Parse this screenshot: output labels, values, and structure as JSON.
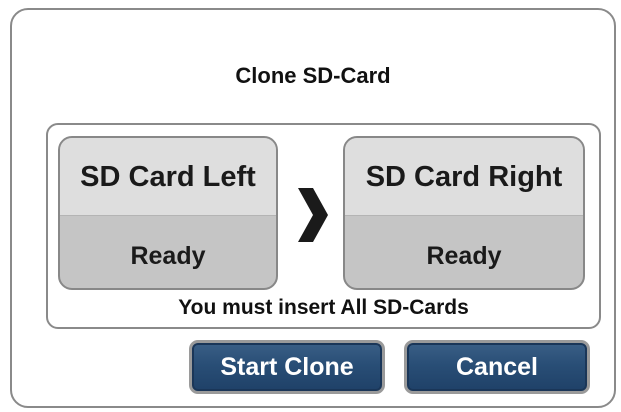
{
  "dialog": {
    "title": "Clone SD-Card",
    "source_card": {
      "name": "SD Card Left",
      "status": "Ready"
    },
    "direction_icon": "chevron-right-icon",
    "target_card": {
      "name": "SD Card Right",
      "status": "Ready"
    },
    "message": "You must insert All SD-Cards",
    "buttons": {
      "start_label": "Start Clone",
      "cancel_label": "Cancel"
    }
  },
  "colors": {
    "button_fill": "#294e76",
    "button_text": "#ffffff",
    "card_top": "#dedede",
    "card_bottom": "#c5c5c5",
    "border": "#8a8a8a"
  }
}
